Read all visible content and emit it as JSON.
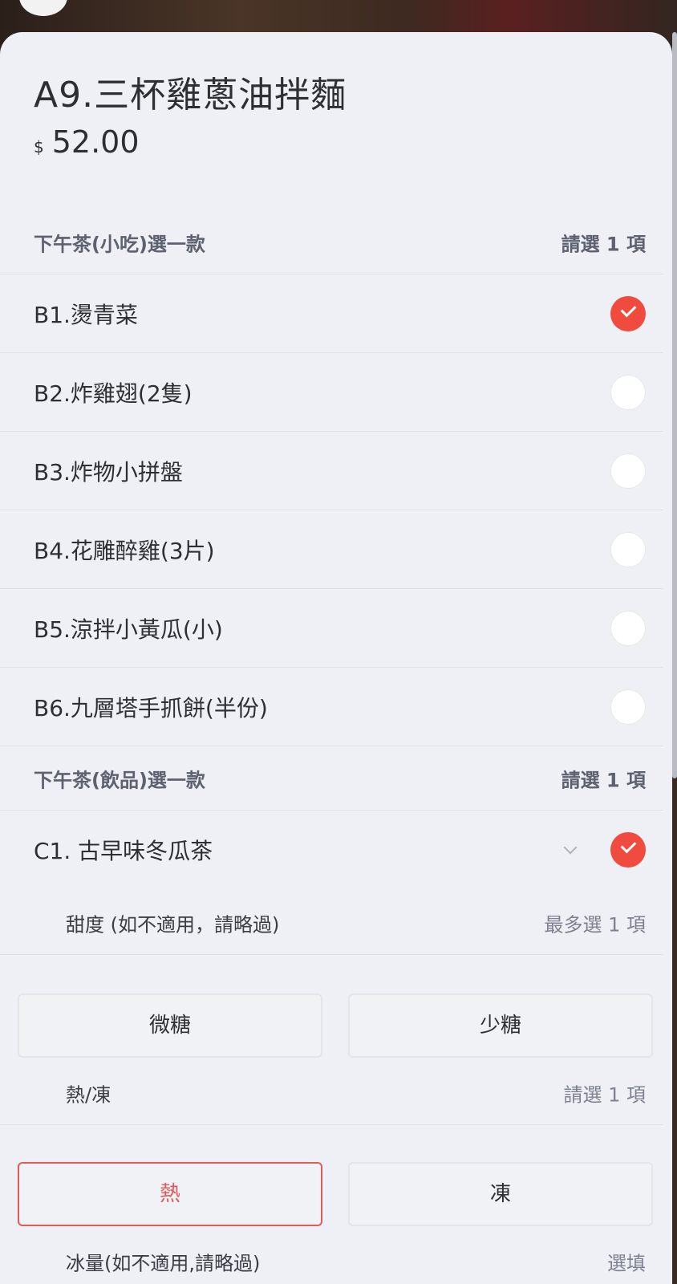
{
  "item": {
    "title": "A9.三杯雞蔥油拌麵",
    "currency": "$",
    "price": "52.00"
  },
  "group1": {
    "label": "下午茶(小吃)選一款",
    "requirement": "請選 1 項",
    "options": [
      {
        "label": "B1.燙青菜",
        "checked": true
      },
      {
        "label": "B2.炸雞翅(2隻)",
        "checked": false
      },
      {
        "label": "B3.炸物小拼盤",
        "checked": false
      },
      {
        "label": "B4.花雕醉雞(3片)",
        "checked": false
      },
      {
        "label": "B5.涼拌小黃瓜(小)",
        "checked": false
      },
      {
        "label": "B6.九層塔手抓餅(半份)",
        "checked": false
      }
    ]
  },
  "group2": {
    "label": "下午茶(飲品)選一款",
    "requirement": "請選 1 項",
    "options": [
      {
        "label": "C1. 古早味冬瓜茶",
        "checked": true,
        "expanded": true
      }
    ]
  },
  "sweetness": {
    "label": "甜度 (如不適用，請略過)",
    "requirement": "最多選 1 項",
    "choices": [
      {
        "label": "微糖",
        "selected": false
      },
      {
        "label": "少糖",
        "selected": false
      }
    ]
  },
  "temperature": {
    "label": "熱/凍",
    "requirement": "請選 1 項",
    "choices": [
      {
        "label": "熱",
        "selected": true
      },
      {
        "label": "凍",
        "selected": false
      }
    ]
  },
  "ice": {
    "label": "冰量(如不適用,請略過)",
    "requirement": "選填"
  },
  "colors": {
    "accent": "#ef4b3f",
    "selected_border": "#e05a5a",
    "sheet_bg": "#eef0f5"
  }
}
